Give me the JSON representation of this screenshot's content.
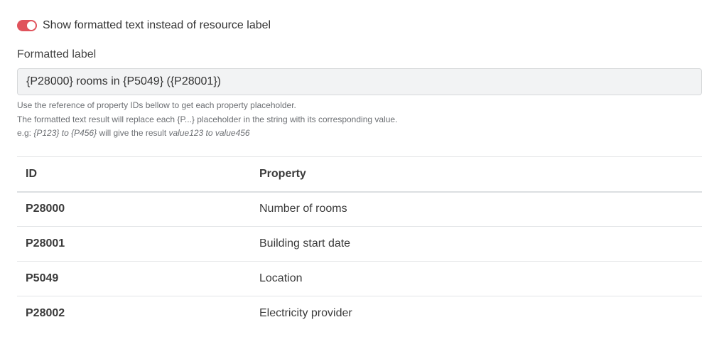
{
  "toggle": {
    "label": "Show formatted text instead of resource label",
    "checked": true,
    "accent_color": "#e0535c"
  },
  "formatted_label": {
    "label": "Formatted label",
    "value": "{P28000} rooms in {P5049} ({P28001})"
  },
  "help": {
    "line1": "Use the reference of property IDs bellow to get each property placeholder.",
    "line2": "The formatted text result will replace each {P...} placeholder in the string with its corresponding value.",
    "line3_prefix": "e.g: ",
    "line3_example": "{P123} to {P456}",
    "line3_middle": " will give the result ",
    "line3_result": "value123 to value456"
  },
  "table": {
    "headers": {
      "id": "ID",
      "property": "Property"
    },
    "rows": [
      {
        "id": "P28000",
        "property": "Number of rooms"
      },
      {
        "id": "P28001",
        "property": "Building start date"
      },
      {
        "id": "P5049",
        "property": "Location"
      },
      {
        "id": "P28002",
        "property": "Electricity provider"
      }
    ]
  }
}
